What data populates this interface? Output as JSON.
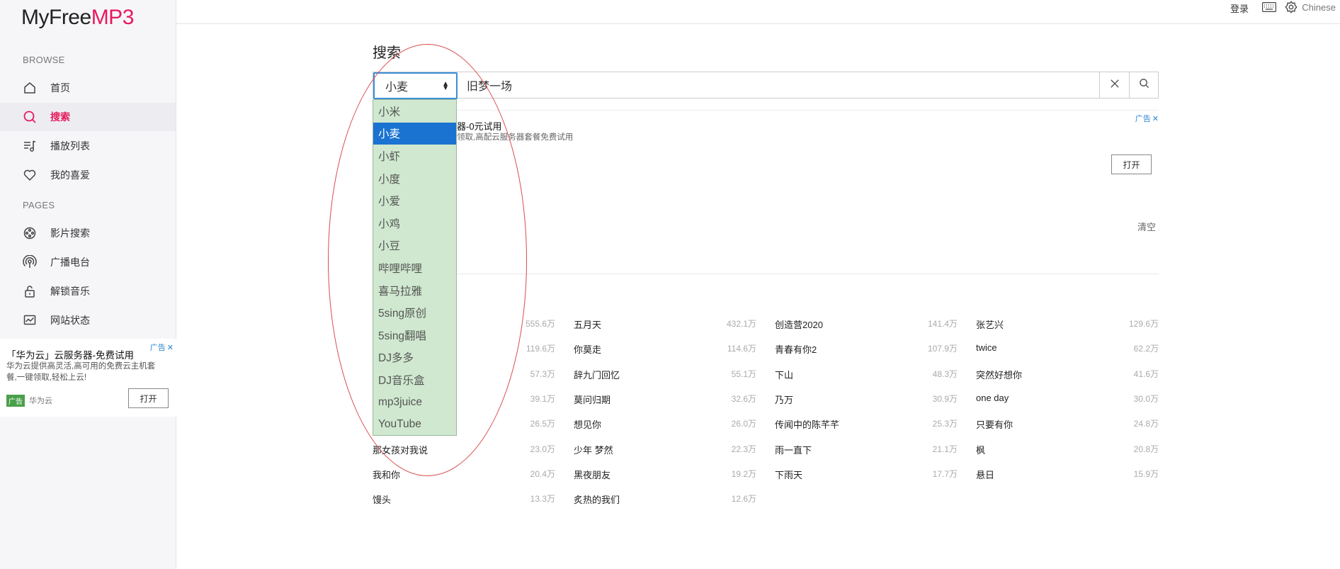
{
  "app": {
    "logo_main": "MyFree",
    "logo_accent": "MP3"
  },
  "sidebar": {
    "browse_title": "BROWSE",
    "pages_title": "PAGES",
    "browse_items": [
      {
        "label": "首页",
        "icon": "home-icon"
      },
      {
        "label": "搜索",
        "icon": "search-icon",
        "active": true
      },
      {
        "label": "播放列表",
        "icon": "playlist-icon"
      },
      {
        "label": "我的喜爱",
        "icon": "heart-icon"
      }
    ],
    "pages_items": [
      {
        "label": "影片搜索",
        "icon": "film-reel-icon"
      },
      {
        "label": "广播电台",
        "icon": "radio-icon"
      },
      {
        "label": "解锁音乐",
        "icon": "unlock-icon"
      },
      {
        "label": "网站状态",
        "icon": "monitor-chart-icon"
      }
    ],
    "ad": {
      "tag": "广告",
      "title": "「华为云」云服务器-免费试用",
      "desc": "华为云提供高灵活,高可用的免费云主机套餐,一键领取,轻松上云!",
      "badge": "广告",
      "source": "华为云",
      "button": "打开"
    }
  },
  "topbar": {
    "login": "登录",
    "language": "Chinese"
  },
  "main": {
    "title": "搜索",
    "search": {
      "selected_source": "小麦",
      "query": "旧梦一场"
    },
    "source_options": [
      "小米",
      "小麦",
      "小虾",
      "小度",
      "小爱",
      "小鸡",
      "小豆",
      "哔哩哔哩",
      "喜马拉雅",
      "5sing原创",
      "5sing翻唱",
      "DJ多多",
      "DJ音乐盒",
      "mp3juice",
      "YouTube"
    ],
    "selected_option_index": 1,
    "ad": {
      "tag": "广告",
      "title_visible": "器-0元试用",
      "desc_visible": "领取,高配云服务器套餐免费试用",
      "button": "打开"
    },
    "clear_label": "清空",
    "hot_searches": [
      {
        "name": "",
        "count": "555.6万"
      },
      {
        "name": "五月天",
        "count": "432.1万"
      },
      {
        "name": "创造营2020",
        "count": "141.4万"
      },
      {
        "name": "张艺兴",
        "count": "129.6万"
      },
      {
        "name": "",
        "count": "119.6万"
      },
      {
        "name": "你莫走",
        "count": "114.6万"
      },
      {
        "name": "青春有你2",
        "count": "107.9万"
      },
      {
        "name": "twice",
        "count": "62.2万"
      },
      {
        "name": "",
        "count": "57.3万"
      },
      {
        "name": "辞九门回忆",
        "count": "55.1万"
      },
      {
        "name": "下山",
        "count": "48.3万"
      },
      {
        "name": "突然好想你",
        "count": "41.6万"
      },
      {
        "name": "",
        "count": "39.1万"
      },
      {
        "name": "莫问归期",
        "count": "32.6万"
      },
      {
        "name": "乃万",
        "count": "30.9万"
      },
      {
        "name": "one day",
        "count": "30.0万"
      },
      {
        "name": "",
        "count": "26.5万"
      },
      {
        "name": "想见你",
        "count": "26.0万"
      },
      {
        "name": "传闻中的陈芊芊",
        "count": "25.3万"
      },
      {
        "name": "只要有你",
        "count": "24.8万"
      },
      {
        "name": "那女孩对我说",
        "count": "23.0万"
      },
      {
        "name": "少年 梦然",
        "count": "22.3万"
      },
      {
        "name": "雨一直下",
        "count": "21.1万"
      },
      {
        "name": "枫",
        "count": "20.8万"
      },
      {
        "name": "我和你",
        "count": "20.4万"
      },
      {
        "name": "黑夜朋友",
        "count": "19.2万"
      },
      {
        "name": "下雨天",
        "count": "17.7万"
      },
      {
        "name": "悬日",
        "count": "15.9万"
      },
      {
        "name": "馒头",
        "count": "13.3万"
      },
      {
        "name": "炙热的我们",
        "count": "12.6万"
      }
    ]
  },
  "colors": {
    "accent": "#e8195b",
    "dropdown_bg": "#cfe8cf",
    "dropdown_selected": "#1a73d1",
    "select_border": "#3a8fd8"
  }
}
